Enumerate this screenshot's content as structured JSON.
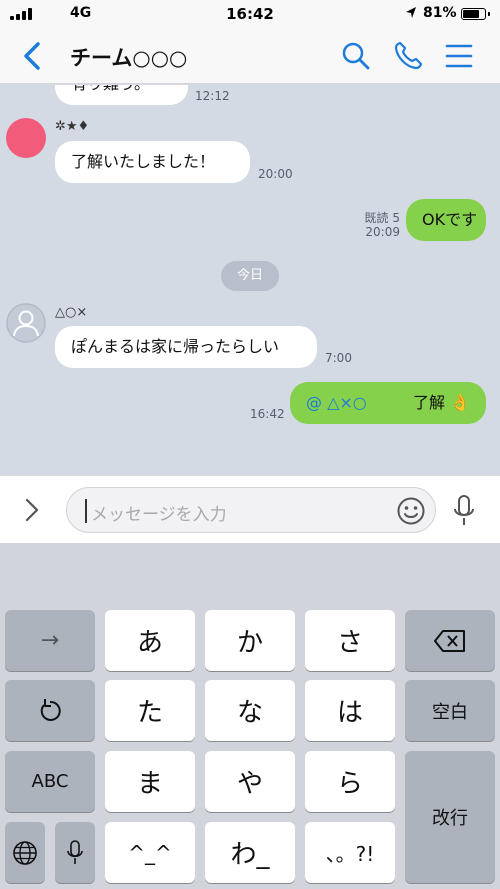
{
  "status_bar": {
    "network": "4G",
    "time": "16:42",
    "battery": "81%",
    "battery_level": 0.81
  },
  "header": {
    "title": "チーム○○○"
  },
  "chat": {
    "messages": [
      {
        "text": "有り難う。",
        "time": "12:12",
        "side": "left"
      },
      {
        "sender": "✲★♦",
        "text": "了解いたしました！",
        "time": "20:00",
        "side": "left"
      },
      {
        "text": "OKです",
        "read": "既読 5",
        "time": "20:09",
        "side": "right"
      },
      {
        "sender": "△○×",
        "text": "ぽんまるは家に帰ったらしい",
        "time": "7:00",
        "side": "left"
      },
      {
        "mention": "@ △×○",
        "text": "了解",
        "emoji": "👌",
        "time": "16:42",
        "side": "right"
      }
    ],
    "date_separator": "今日"
  },
  "input": {
    "placeholder": "メッセージを入力"
  },
  "keyboard": {
    "rows": [
      [
        "→",
        "あ",
        "か",
        "さ",
        "⌫"
      ],
      [
        "↺",
        "た",
        "な",
        "は",
        "空白"
      ],
      [
        "ABC",
        "ま",
        "や",
        "ら",
        "改行"
      ],
      [
        "globe-icon",
        "mic-icon",
        "^_^",
        "わ_",
        "、。?!"
      ]
    ]
  },
  "colors": {
    "accent": "#1e7bd9",
    "chat_bg": "#d3dae3",
    "green_bubble": "#85d14c",
    "mention": "#1e7bd9"
  }
}
